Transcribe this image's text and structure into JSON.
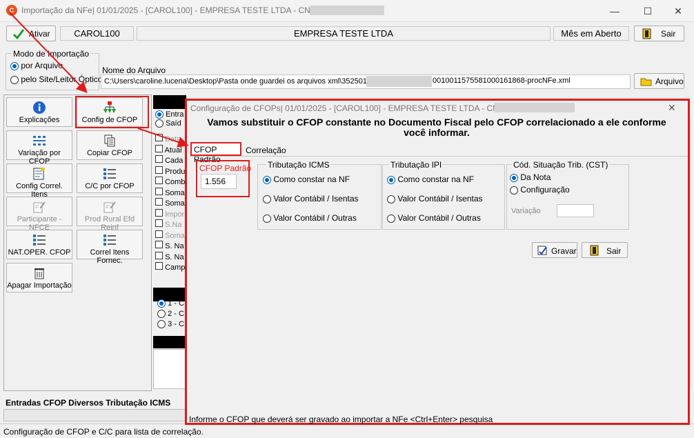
{
  "window": {
    "title": "Importação da NFe|  01/01/2025 - [CAROL100] - EMPRESA TESTE LTDA - CNPJ:",
    "minimize": "—",
    "maximize": "☐",
    "close": "✕"
  },
  "toolbar": {
    "ativar_label": "Ativar",
    "user": "CAROL100",
    "company": "EMPRESA TESTE LTDA",
    "month_status": "Mês em Aberto",
    "sair_label": "Sair"
  },
  "import_mode": {
    "legend": "Modo de Importação",
    "option_file": "por Arquivo",
    "option_site": "pelo Site/Leitor Óptico"
  },
  "file": {
    "label": "Nome do Arquivo",
    "path_start": "C:\\Users\\caroline.lucena\\Desktop\\Pasta onde guardei os arquivos xml\\352501",
    "path_end": "001001157558100016186​8-procNFe.xml",
    "arquivo_button": "Arquivo"
  },
  "tools": [
    {
      "label": "Explicações",
      "icon": "info-icon"
    },
    {
      "label": "Config de CFOP",
      "icon": "hierarchy-icon"
    },
    {
      "label": "Variação por CFOP",
      "icon": "grid-icon"
    },
    {
      "label": "Copiar CFOP",
      "icon": "copy-icon"
    },
    {
      "label": "Config Correl. Itens",
      "icon": "form-icon"
    },
    {
      "label": "C/C por CFOP",
      "icon": "list-icon"
    },
    {
      "label": "Participante - NFCE",
      "icon": "edit-icon"
    },
    {
      "label": "Prod Rural Efd Reinf",
      "icon": "edit-icon"
    },
    {
      "label": "NAT.OPER. CFOP",
      "icon": "list-icon"
    },
    {
      "label": "Correl Itens Fornec.",
      "icon": "list-icon"
    },
    {
      "label": "Apagar Importação",
      "icon": "trash-icon"
    }
  ],
  "background_options": {
    "radios": [
      "Entra",
      "Saíd"
    ],
    "checks": [
      "Data",
      "Atual",
      "Cada",
      "Produ",
      "Comb",
      "Soma",
      "Soma",
      "Impor",
      "S.Na",
      "Soma",
      "S. Na",
      "S. Na",
      "Camp"
    ],
    "bottom_radios": [
      "1 - C",
      "2 - C",
      "3 - C"
    ]
  },
  "bottom_tabs": [
    "Entradas",
    "CFOP",
    "Diversos",
    "Tributação ICMS"
  ],
  "status_bar": "Configuração de CFOP e C/C para lista de correlação.",
  "dialog": {
    "title": "Configuração de CFOPs|  01/01/2025 - [CAROL100] - EMPRESA TESTE LTDA - CNPJ:",
    "close": "✕",
    "heading": "Vamos substituir o CFOP constante no Documento Fiscal pelo CFOP correlacionado a ele conforme você informar.",
    "tabs": [
      "CFOP Padrão",
      "Correlação"
    ],
    "cfop_label": "CFOP Padrão",
    "cfop_value": "1.556",
    "icms": {
      "legend": "Tributação ICMS",
      "options": [
        "Como constar na NF",
        "Valor Contábil / Isentas",
        "Valor Contábil / Outras"
      ]
    },
    "ipi": {
      "legend": "Tributação IPI",
      "options": [
        "Como constar na NF",
        "Valor Contábil / Isentas",
        "Valor Contábil / Outras"
      ]
    },
    "cst": {
      "legend": "Cód. Situação Trib. (CST)",
      "options": [
        "Da Nota",
        "Configuração"
      ],
      "variacao_label": "Variação",
      "variacao_value": ""
    },
    "gravar_label": "Gravar",
    "sair_label": "Sair",
    "footer": "Informe o CFOP que deverá ser gravado ao importar a NFe   <Ctrl+Enter> pesquisa"
  },
  "colors": {
    "highlight": "#e01b1b",
    "accent": "#0063b1"
  }
}
